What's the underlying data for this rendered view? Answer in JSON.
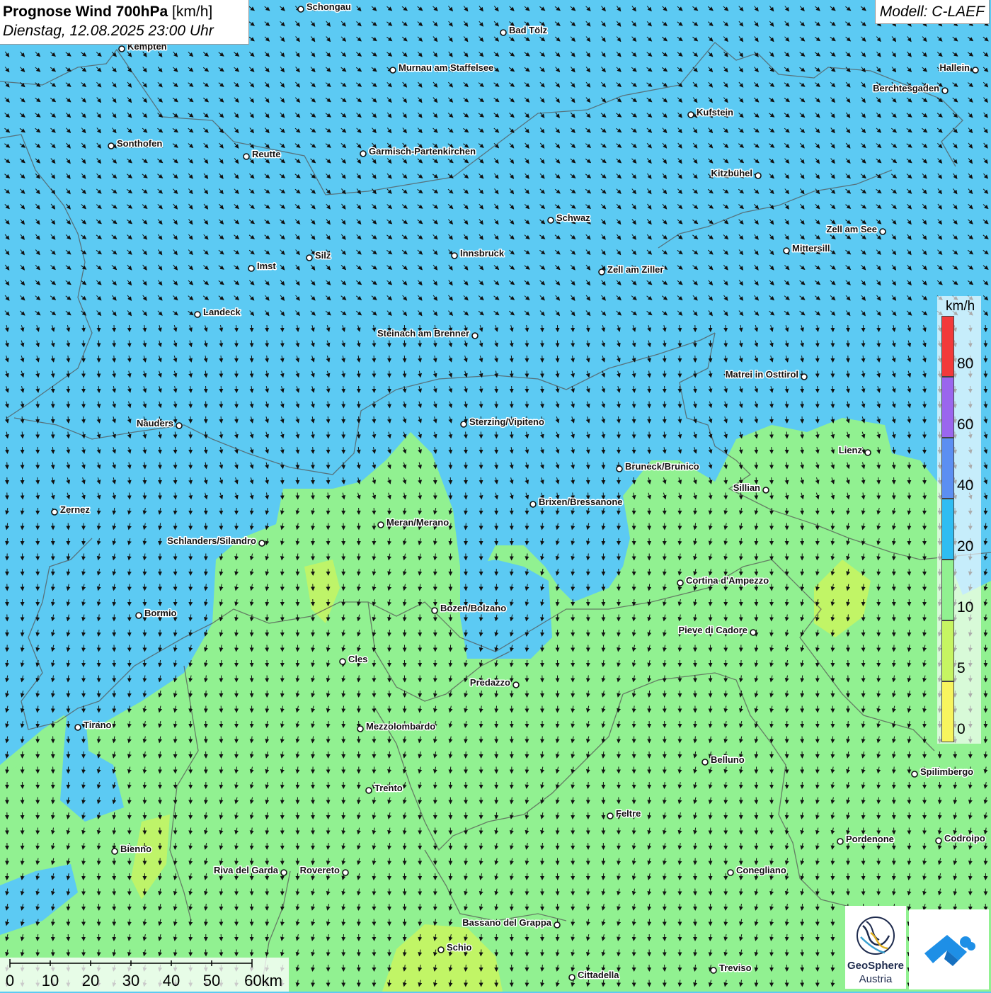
{
  "header": {
    "title_bold": "Prognose Wind 700hPa",
    "title_unit": "[km/h]",
    "date": "Dienstag, 12.08.2025 23:00 Uhr",
    "model": "Modell: C-LAEF"
  },
  "legend": {
    "unit": "km/h",
    "bands": [
      {
        "from": 0,
        "to": 5,
        "color": "#f7f55e"
      },
      {
        "from": 5,
        "to": 10,
        "color": "#c6f562"
      },
      {
        "from": 10,
        "to": 20,
        "color": "#91f191"
      },
      {
        "from": 20,
        "to": 40,
        "color": "#2fbdf2"
      },
      {
        "from": 40,
        "to": 60,
        "color": "#5b8ff2"
      },
      {
        "from": 60,
        "to": 80,
        "color": "#9a66ee"
      },
      {
        "from": 80,
        "to": 100,
        "color": "#f23a3a"
      }
    ],
    "tick_labels": [
      "0",
      "5",
      "10",
      "20",
      "40",
      "60",
      "80"
    ]
  },
  "scalebar": {
    "labels": [
      "0",
      "10",
      "20",
      "30",
      "40",
      "50",
      "60km"
    ]
  },
  "cities": [
    {
      "name": "Schongau"
    },
    {
      "name": "Bad Tölz"
    },
    {
      "name": "Kempten"
    },
    {
      "name": "Murnau am Staffelsee"
    },
    {
      "name": "Hallein"
    },
    {
      "name": "Berchtesgaden"
    },
    {
      "name": "Kufstein"
    },
    {
      "name": "Sonthofen"
    },
    {
      "name": "Reutte"
    },
    {
      "name": "Garmisch-Partenkirchen"
    },
    {
      "name": "Kitzbühel"
    },
    {
      "name": "Schwaz"
    },
    {
      "name": "Zell am See"
    },
    {
      "name": "Mittersill"
    },
    {
      "name": "Innsbruck"
    },
    {
      "name": "Silz"
    },
    {
      "name": "Imst"
    },
    {
      "name": "Zell am Ziller"
    },
    {
      "name": "Landeck"
    },
    {
      "name": "Steinach am Brenner"
    },
    {
      "name": "Matrei in Osttirol"
    },
    {
      "name": "Nauders"
    },
    {
      "name": "Sterzing/Vipiteno"
    },
    {
      "name": "Lienz"
    },
    {
      "name": "Bruneck/Brunico"
    },
    {
      "name": "Sillian"
    },
    {
      "name": "Zernez"
    },
    {
      "name": "Brixen/Bressanone"
    },
    {
      "name": "Meran/Merano"
    },
    {
      "name": "Schlanders/Silandro"
    },
    {
      "name": "Cortina d'Ampezzo"
    },
    {
      "name": "Bozen/Bolzano"
    },
    {
      "name": "Bormio"
    },
    {
      "name": "Pieve di Cadore"
    },
    {
      "name": "Cles"
    },
    {
      "name": "Predazzo"
    },
    {
      "name": "Tirano"
    },
    {
      "name": "Mezzolombardo"
    },
    {
      "name": "Belluno"
    },
    {
      "name": "Spilimbergo"
    },
    {
      "name": "Trento"
    },
    {
      "name": "Feltre"
    },
    {
      "name": "Pordenone"
    },
    {
      "name": "Codroipo"
    },
    {
      "name": "Bienno"
    },
    {
      "name": "Riva del Garda"
    },
    {
      "name": "Rovereto"
    },
    {
      "name": "Conegliano"
    },
    {
      "name": "Bassano del Grappa"
    },
    {
      "name": "Schio"
    },
    {
      "name": "Treviso"
    },
    {
      "name": "Cittadella"
    }
  ],
  "logos": {
    "geosphere_line1": "GeoSphere",
    "geosphere_line2": "Austria"
  },
  "colors": {
    "wind_10_20": "#91f191",
    "wind_20_40": "#5ccaf3",
    "wind_5_10": "#c6f562",
    "border": "#555555"
  }
}
